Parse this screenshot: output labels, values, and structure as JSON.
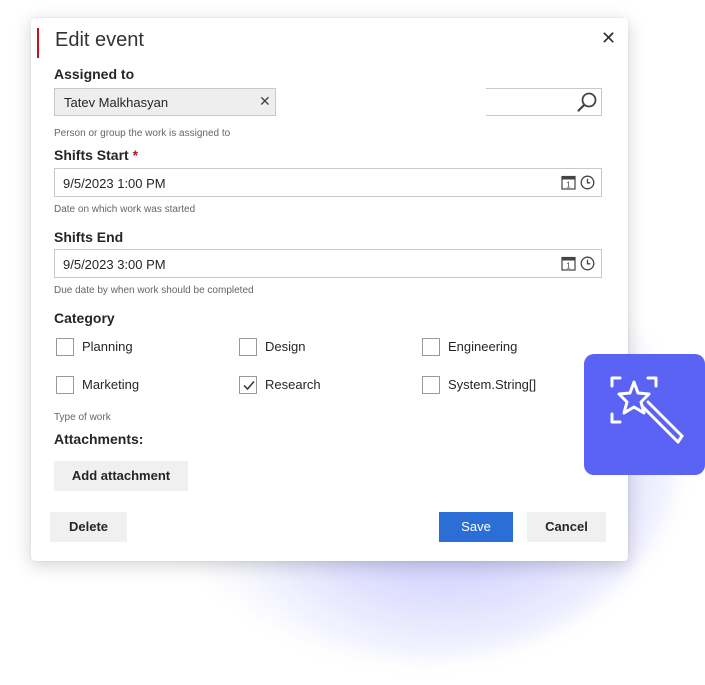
{
  "dialog": {
    "title": "Edit event",
    "close_symbol": "✕"
  },
  "assigned_to": {
    "label": "Assigned to",
    "value": "Tatev Malkhasyan",
    "remove_symbol": "✕",
    "hint": "Person or group the work is assigned to"
  },
  "shifts_start": {
    "label": "Shifts Start",
    "required_mark": "*",
    "value": "9/5/2023 1:00 PM",
    "hint": "Date on which work was started"
  },
  "shifts_end": {
    "label": "Shifts End",
    "value": "9/5/2023 3:00 PM",
    "hint": "Due date by when work should be completed"
  },
  "category": {
    "label": "Category",
    "options": [
      {
        "label": "Planning",
        "checked": false
      },
      {
        "label": "Design",
        "checked": false
      },
      {
        "label": "Engineering",
        "checked": false
      },
      {
        "label": "Marketing",
        "checked": false
      },
      {
        "label": "Research",
        "checked": true
      },
      {
        "label": "System.String[]",
        "checked": false
      }
    ],
    "hint": "Type of work"
  },
  "attachments": {
    "label": "Attachments:",
    "add_button": "Add attachment"
  },
  "footer": {
    "delete_label": "Delete",
    "save_label": "Save",
    "cancel_label": "Cancel"
  },
  "colors": {
    "accent_red": "#c50f1f",
    "primary_blue": "#2b6fd6",
    "magic_tile": "#5b63f5"
  },
  "icons": {
    "close": "close-icon",
    "search": "search-icon",
    "calendar": "calendar-icon",
    "clock": "clock-icon",
    "magic": "magic-wand-icon"
  }
}
